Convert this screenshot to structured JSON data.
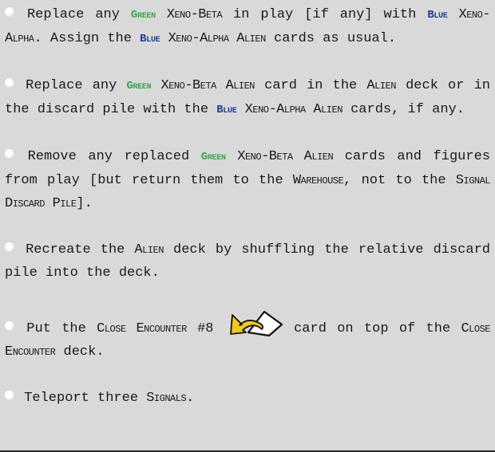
{
  "paragraphs": [
    {
      "p1_t1": " Replace any ",
      "p1_green": "Green",
      "p1_t2": " ",
      "p1_sc1": "Xeno-Beta",
      "p1_t3": " in play [if any] with ",
      "p1_blue": "Blue",
      "p1_t4": " ",
      "p1_sc2": "Xeno-Alpha",
      "p1_t5": ". Assign the ",
      "p1_blue2": "Blue",
      "p1_t6": " ",
      "p1_sc3": "Xeno-Alpha Alien",
      "p1_t7": " cards as usual."
    }
  ],
  "p1": {
    "t1": " Replace any ",
    "green": "Green",
    "t2": " ",
    "sc1": "Xeno-Beta",
    "t3": " in play [if any] with ",
    "blue": "Blue",
    "t4": " ",
    "sc2": "Xeno-Alpha",
    "t5": ". Assign the ",
    "blue2": "Blue",
    "t6": " ",
    "sc3": "Xeno-Alpha Alien",
    "t7": " cards as usual."
  },
  "p2": {
    "t1": " Replace any ",
    "green": "Green",
    "t2": " ",
    "sc1": "Xeno-Beta Alien",
    "t3": " card in the ",
    "sc2": "Alien",
    "t4": " deck or in the discard pile with the ",
    "blue": "Blue",
    "t5": " ",
    "sc3": "Xeno-Alpha Alien",
    "t6": " cards, if any."
  },
  "p3": {
    "t1": " Remove any replaced ",
    "green": "Green",
    "t2": " ",
    "sc1": "Xeno-Beta Alien",
    "t3": " cards and figures from play [but return them to the ",
    "sc2": "Warehouse",
    "t4": ", not to the ",
    "sc3": "Signal Discard Pile",
    "t5": "]."
  },
  "p4": {
    "t1": " Recreate the ",
    "sc1": "Alien",
    "t2": " deck by shuffling the relative discard pile into the deck."
  },
  "p5": {
    "t1": " Put the ",
    "sc1": "Close Encounter",
    "t2": " #8 ",
    "t3": " card on top of the ",
    "sc2": "Close Encounter",
    "t4": " deck."
  },
  "p6": {
    "t1": " Teleport three ",
    "sc1": "Signals",
    "t2": "."
  },
  "colors": {
    "green": "#3aa84a",
    "blue": "#1f3f96",
    "arrow": "#f2c81a",
    "background": "#d9d9d9"
  },
  "icons": {
    "card_icon": "card-flip-arrow-icon"
  }
}
